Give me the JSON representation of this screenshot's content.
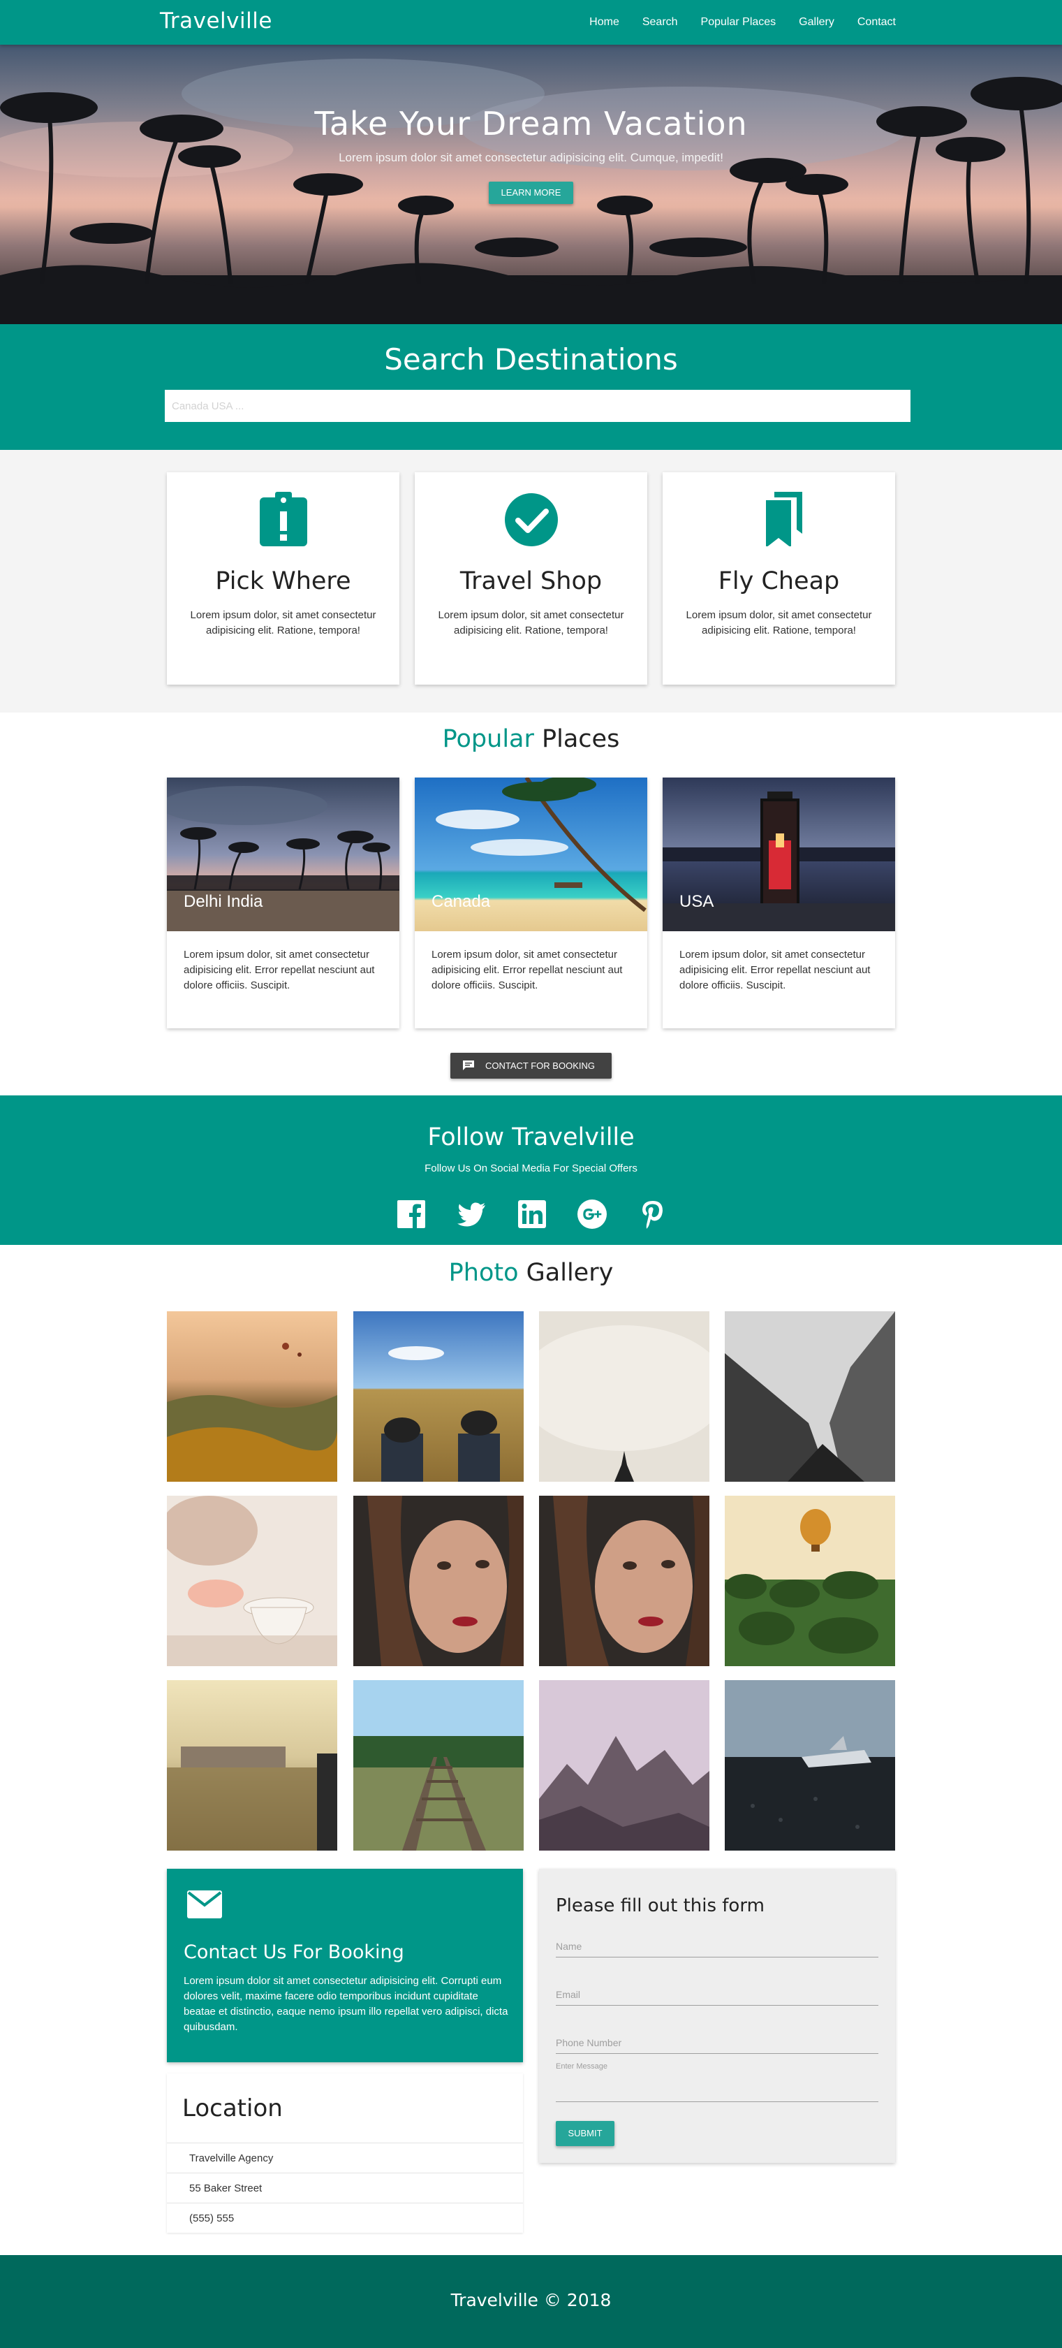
{
  "nav": {
    "brand": "Travelville",
    "links": [
      "Home",
      "Search",
      "Popular Places",
      "Gallery",
      "Contact"
    ]
  },
  "hero": {
    "title": "Take Your Dream Vacation",
    "subtitle": "Lorem ipsum dolor sit amet consectetur adipisicing elit. Cumque, impedit!",
    "button": "LEARN MORE"
  },
  "search": {
    "title": "Search Destinations",
    "placeholder": "Canada USA ..."
  },
  "features": [
    {
      "icon": "assignment-late-icon",
      "title": "Pick Where",
      "text": "Lorem ipsum dolor, sit amet consectetur adipisicing elit. Ratione, tempora!"
    },
    {
      "icon": "check-circle-icon",
      "title": "Travel Shop",
      "text": "Lorem ipsum dolor, sit amet consectetur adipisicing elit. Ratione, tempora!"
    },
    {
      "icon": "bookmarks-icon",
      "title": "Fly Cheap",
      "text": "Lorem ipsum dolor, sit amet consectetur adipisicing elit. Ratione, tempora!"
    }
  ],
  "popular": {
    "title_accent": "Popular",
    "title_rest": "Places",
    "cards": [
      {
        "label": "Delhi India",
        "text": "Lorem ipsum dolor, sit amet consectetur adipisicing elit. Error repellat nesciunt aut dolore officiis. Suscipit."
      },
      {
        "label": "Canada",
        "text": "Lorem ipsum dolor, sit amet consectetur adipisicing elit. Error repellat nesciunt aut dolore officiis. Suscipit."
      },
      {
        "label": "USA",
        "text": "Lorem ipsum dolor, sit amet consectetur adipisicing elit. Error repellat nesciunt aut dolore officiis. Suscipit."
      }
    ],
    "button": "CONTACT FOR BOOKING"
  },
  "follow": {
    "title": "Follow Travelville",
    "subtitle": "Follow Us On Social Media For Special Offers",
    "icons": [
      "facebook-icon",
      "twitter-icon",
      "linkedin-icon",
      "google-plus-icon",
      "pinterest-icon"
    ]
  },
  "gallery": {
    "title_accent": "Photo",
    "title_rest": "Gallery"
  },
  "contact": {
    "title": "Contact Us For Booking",
    "text": "Lorem ipsum dolor sit amet consectetur adipisicing elit. Corrupti eum dolores velit, maxime facere odio temporibus incidunt cupiditate beatae et distinctio, eaque nemo ipsum illo repellat vero adipisci, dicta quibusdam."
  },
  "location": {
    "title": "Location",
    "items": [
      "Travelville Agency",
      "55 Baker Street",
      "(555) 555"
    ]
  },
  "form": {
    "title": "Please fill out this form",
    "name_placeholder": "Name",
    "email_placeholder": "Email",
    "phone_placeholder": "Phone Number",
    "message_label": "Enter Message",
    "submit": "SUBMIT"
  },
  "footer": {
    "text": "Travelville © 2018"
  },
  "colors": {
    "primary": "#009688",
    "primary_light": "#26a69a",
    "dark": "#00695c",
    "button_dark": "#424242"
  }
}
